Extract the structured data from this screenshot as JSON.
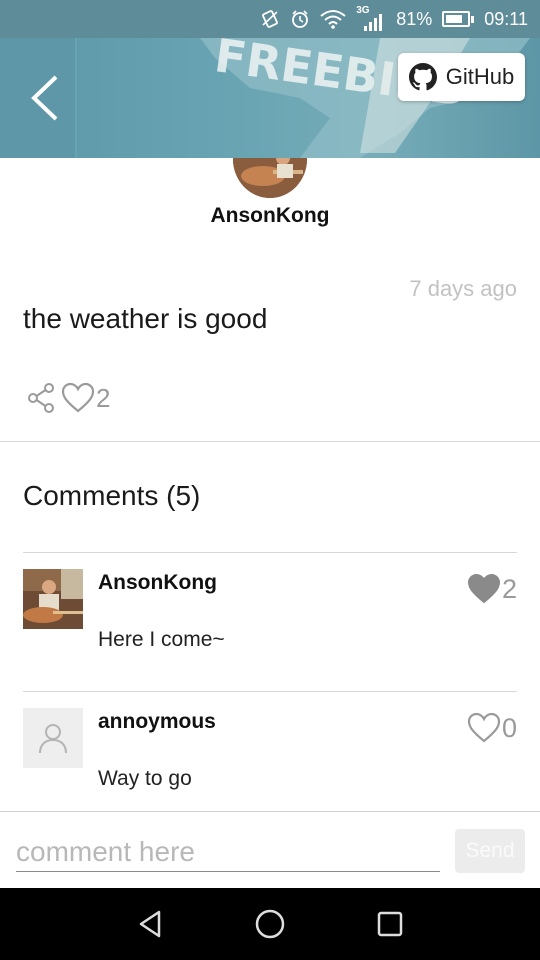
{
  "status_bar": {
    "network_type": "3G",
    "battery_percent": "81%",
    "battery_level": 0.81,
    "time": "09:11",
    "icons": [
      "vibrate-icon",
      "alarm-icon",
      "wifi-icon",
      "signal-icon",
      "battery-icon"
    ]
  },
  "header": {
    "back_icon": "back-arrow-icon",
    "github_label": "GitHub",
    "github_icon": "github-icon",
    "banner_text": "FREEBIRD"
  },
  "post": {
    "author": "AnsonKong",
    "time": "7 days ago",
    "text": "the weather is good",
    "like_count": "2",
    "share_icon": "share-icon",
    "like_icon": "heart-outline-icon"
  },
  "comments": {
    "title": "Comments (5)",
    "items": [
      {
        "name": "AnsonKong",
        "text": "Here I come~",
        "likes": "2",
        "liked": true,
        "avatar": "photo-avatar"
      },
      {
        "name": "annoymous",
        "text": "Way to go",
        "likes": "0",
        "liked": false,
        "avatar": "default-user-avatar"
      }
    ]
  },
  "composer": {
    "placeholder": "comment here",
    "value": "",
    "send_label": "Send"
  },
  "nav": {
    "icons": [
      "nav-back-icon",
      "nav-home-icon",
      "nav-recents-icon"
    ]
  },
  "colors": {
    "status_bar": "#5f8c99",
    "header": "#67a3b2",
    "muted_text": "#9a9a9a",
    "divider": "#d8d8d8"
  }
}
